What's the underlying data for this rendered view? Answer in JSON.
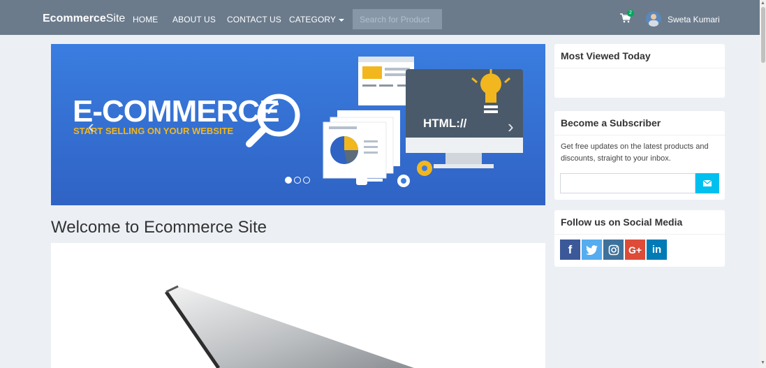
{
  "nav": {
    "brand_bold": "Ecommerce",
    "brand_rest": "Site",
    "links": [
      "HOME",
      "ABOUT US",
      "CONTACT US",
      "CATEGORY"
    ],
    "search_placeholder": "Search for Product",
    "cart_count": "2",
    "user_name": "Sweta Kumari"
  },
  "carousel": {
    "title": "E-COMMERCE",
    "subtitle": "START SELLING ON YOUR WEBSITE",
    "badge_text": "HTML://",
    "prev_icon": "chevron-left-icon",
    "next_icon": "chevron-right-icon",
    "slide_count": 3,
    "active_slide": 1
  },
  "main": {
    "welcome": "Welcome to Ecommerce Site"
  },
  "sidebar": {
    "most_viewed_title": "Most Viewed Today",
    "subscriber_title": "Become a Subscriber",
    "subscriber_text": "Get free updates on the latest products and discounts, straight to your inbox.",
    "social_title": "Follow us on Social Media",
    "social_icons": [
      "facebook-icon",
      "twitter-icon",
      "instagram-icon",
      "google-plus-icon",
      "linkedin-icon"
    ]
  },
  "colors": {
    "navbar": "#6b7b8c",
    "accent": "#00c0ef",
    "carousel_blue": "#3a7de0",
    "carousel_yellow": "#f2b71e",
    "facebook": "#3b5998",
    "twitter": "#55acee",
    "instagram": "#3f729b",
    "google_plus": "#dd4b39",
    "linkedin": "#007bb6"
  }
}
